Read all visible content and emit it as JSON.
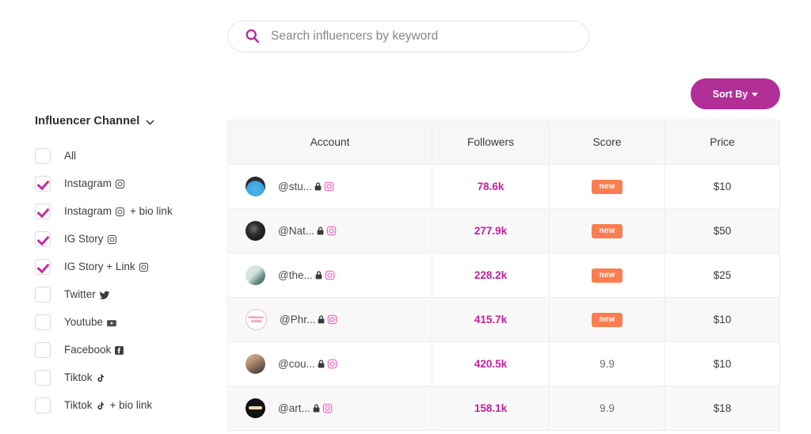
{
  "search": {
    "placeholder": "Search influencers by keyword",
    "value": "",
    "icon": "search-icon"
  },
  "sort": {
    "label": "Sort By",
    "icon": "caret-down-icon",
    "color": "#b12f96"
  },
  "sidebar": {
    "title": "Influencer Channel",
    "chevron_icon": "chevron-down-icon",
    "items": [
      {
        "label": "All",
        "checked": false,
        "icon": ""
      },
      {
        "label": "Instagram",
        "checked": true,
        "icon": "instagram-icon"
      },
      {
        "label": "Instagram",
        "suffix": "+ bio link",
        "checked": true,
        "icon": "instagram-icon"
      },
      {
        "label": "IG Story",
        "checked": true,
        "icon": "instagram-icon"
      },
      {
        "label": "IG Story + Link",
        "checked": true,
        "icon": "instagram-icon"
      },
      {
        "label": "Twitter",
        "checked": false,
        "icon": "twitter-icon"
      },
      {
        "label": "Youtube",
        "checked": false,
        "icon": "youtube-icon"
      },
      {
        "label": "Facebook",
        "checked": false,
        "icon": "facebook-icon"
      },
      {
        "label": "Tiktok",
        "checked": false,
        "icon": "tiktok-icon"
      },
      {
        "label": "Tiktok",
        "suffix": "+ bio link",
        "checked": false,
        "icon": "tiktok-icon"
      }
    ]
  },
  "table": {
    "columns": [
      "Account",
      "Followers",
      "Score",
      "Price"
    ],
    "rows": [
      {
        "handle": "@stu...",
        "followers": "78.6k",
        "score": "new",
        "score_is_badge": true,
        "price": "$10",
        "avatar": "av1"
      },
      {
        "handle": "@Nat...",
        "followers": "277.9k",
        "score": "new",
        "score_is_badge": true,
        "price": "$50",
        "avatar": "av2"
      },
      {
        "handle": "@the...",
        "followers": "228.2k",
        "score": "new",
        "score_is_badge": true,
        "price": "$25",
        "avatar": "av3"
      },
      {
        "handle": "@Phr...",
        "followers": "415.7k",
        "score": "new",
        "score_is_badge": true,
        "price": "$10",
        "avatar": "av4"
      },
      {
        "handle": "@cou...",
        "followers": "420.5k",
        "score": "9.9",
        "score_is_badge": false,
        "price": "$10",
        "avatar": "av5"
      },
      {
        "handle": "@art...",
        "followers": "158.1k",
        "score": "9.9",
        "score_is_badge": false,
        "price": "$18",
        "avatar": "av6"
      }
    ],
    "colors": {
      "followers": "#c4219b",
      "badge_new": "#fb7d50",
      "header_bg": "#f7f7f7",
      "alt_row_bg": "#f8f8f8"
    }
  }
}
